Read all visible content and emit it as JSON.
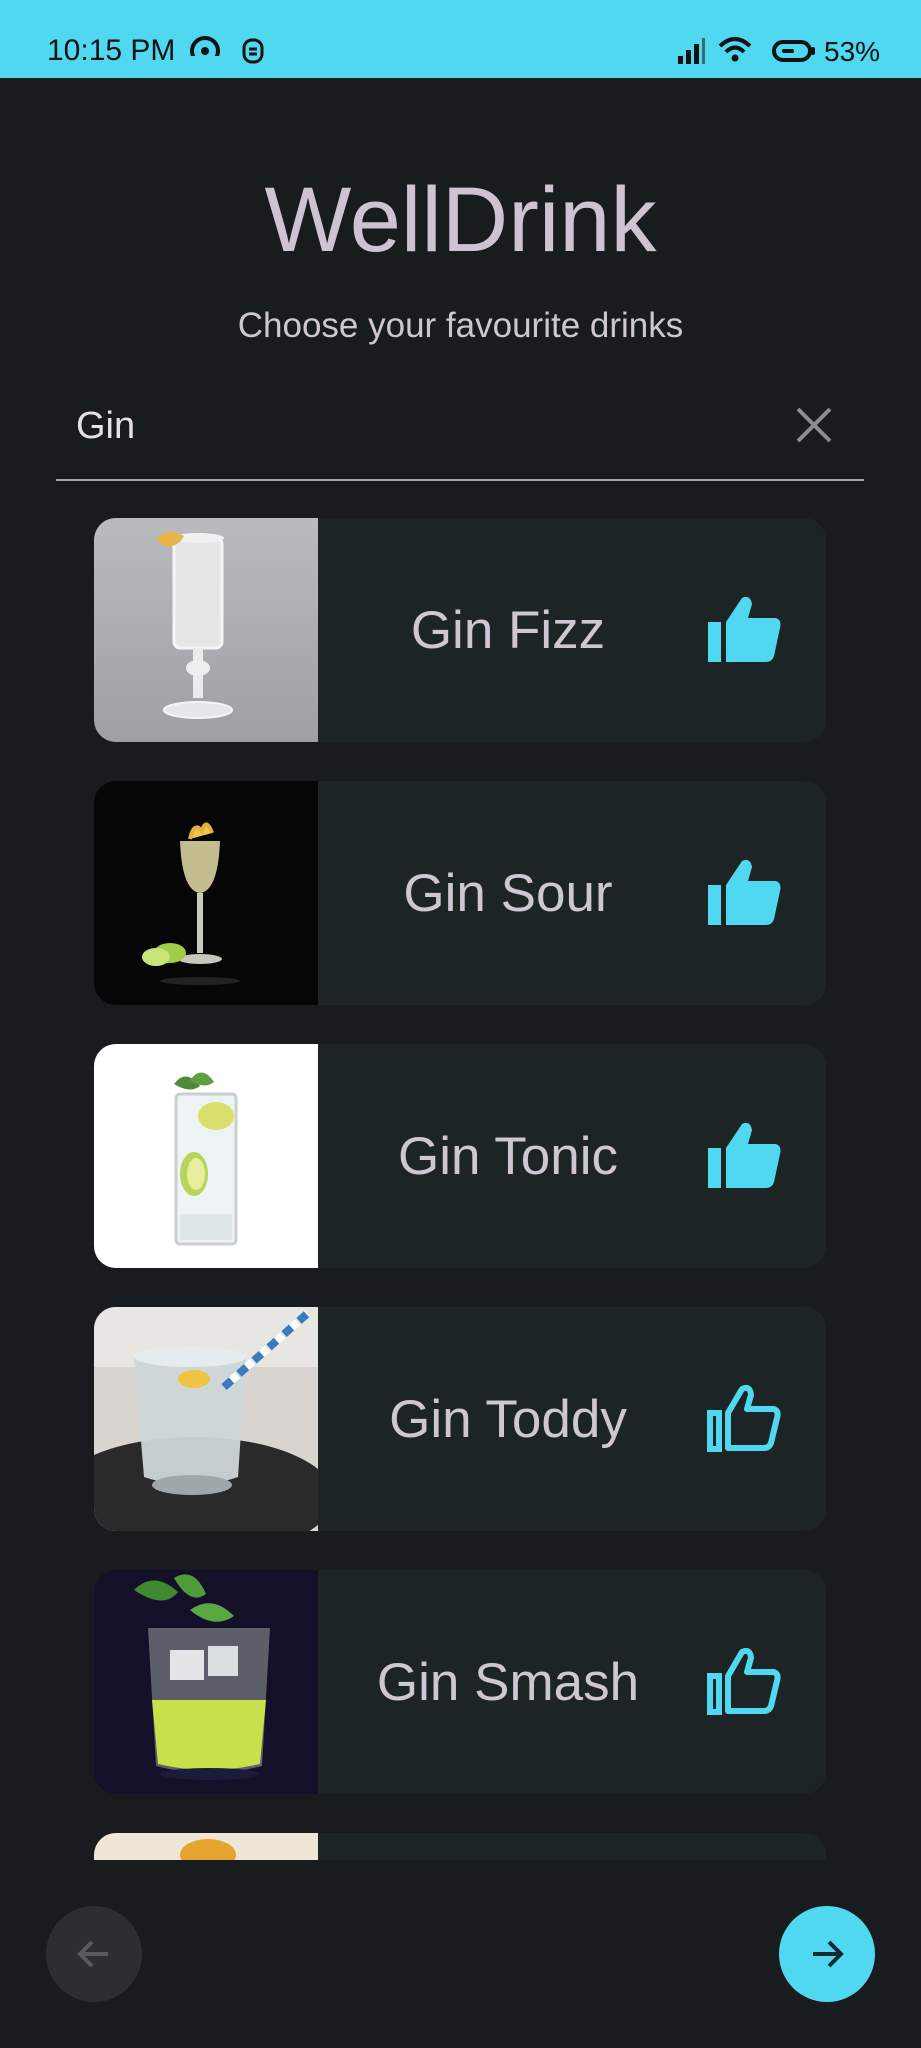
{
  "status_bar": {
    "time": "10:15 PM",
    "battery": "53%",
    "icons": [
      "hotspot-icon",
      "alarm-icon",
      "signal-icon",
      "wifi-icon",
      "battery-icon"
    ]
  },
  "app": {
    "title": "WellDrink",
    "subtitle": "Choose your favourite drinks"
  },
  "search": {
    "value": "Gin",
    "clear_icon": "close-icon"
  },
  "drinks": [
    {
      "name": "Gin Fizz",
      "liked": true,
      "like_icon": "thumb-up-filled-icon"
    },
    {
      "name": "Gin Sour",
      "liked": true,
      "like_icon": "thumb-up-filled-icon"
    },
    {
      "name": "Gin Tonic",
      "liked": true,
      "like_icon": "thumb-up-filled-icon"
    },
    {
      "name": "Gin Toddy",
      "liked": false,
      "like_icon": "thumb-up-outline-icon"
    },
    {
      "name": "Gin Smash",
      "liked": false,
      "like_icon": "thumb-up-outline-icon"
    },
    {
      "name": "",
      "liked": false,
      "like_icon": ""
    }
  ],
  "navigation": {
    "back_icon": "arrow-left-icon",
    "next_icon": "arrow-right-icon"
  },
  "colors": {
    "accent": "#4fd8ef",
    "background": "#191c1e",
    "card": "#1d2426",
    "text": "#cfc6d3"
  }
}
